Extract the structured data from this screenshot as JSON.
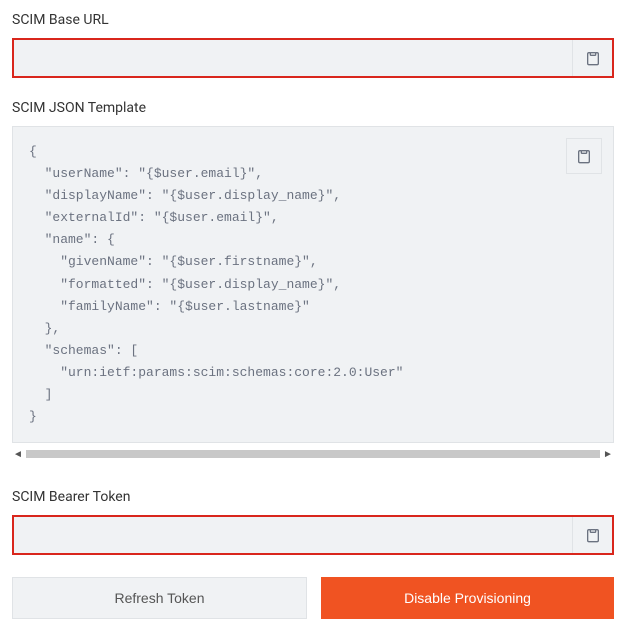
{
  "sections": {
    "baseUrl": {
      "label": "SCIM Base URL",
      "value": ""
    },
    "jsonTemplate": {
      "label": "SCIM JSON Template",
      "code": "{\n  \"userName\": \"{$user.email}\",\n  \"displayName\": \"{$user.display_name}\",\n  \"externalId\": \"{$user.email}\",\n  \"name\": {\n    \"givenName\": \"{$user.firstname}\",\n    \"formatted\": \"{$user.display_name}\",\n    \"familyName\": \"{$user.lastname}\"\n  },\n  \"schemas\": [\n    \"urn:ietf:params:scim:schemas:core:2.0:User\"\n  ]\n}"
    },
    "bearerToken": {
      "label": "SCIM Bearer Token",
      "value": ""
    }
  },
  "buttons": {
    "refresh": "Refresh Token",
    "disable": "Disable Provisioning"
  },
  "scrollArrows": {
    "left": "◄",
    "right": "►"
  }
}
